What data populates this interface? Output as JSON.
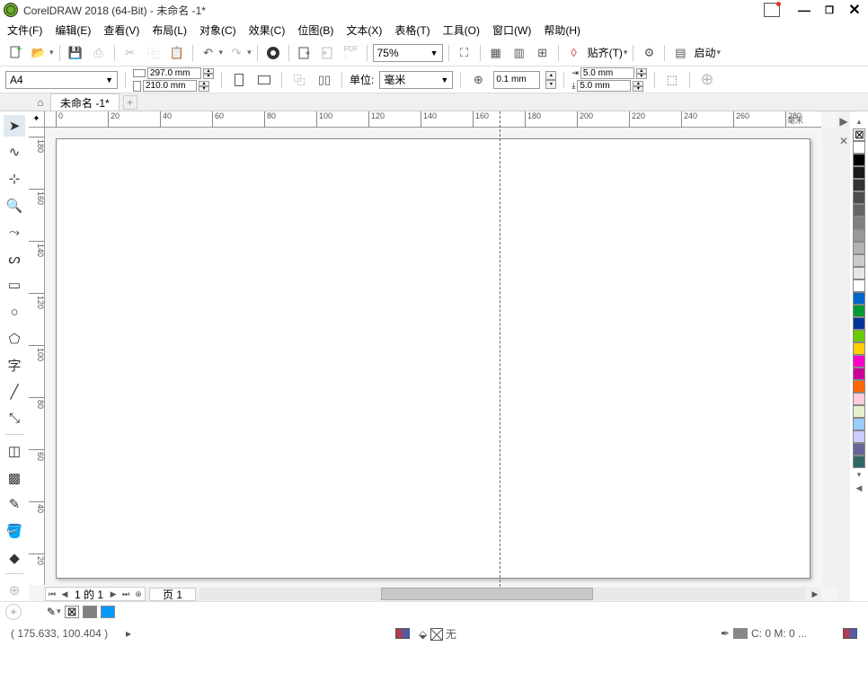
{
  "title": "CorelDRAW 2018 (64-Bit) - 未命名 -1*",
  "menu": {
    "file": "文件(F)",
    "edit": "编辑(E)",
    "view": "查看(V)",
    "layout": "布局(L)",
    "object": "对象(C)",
    "effects": "效果(C)",
    "bitmap": "位图(B)",
    "text": "文本(X)",
    "table": "表格(T)",
    "tools": "工具(O)",
    "window": "窗口(W)",
    "help": "帮助(H)"
  },
  "toolbar": {
    "zoom": "75%",
    "snap": "贴齐(T)",
    "launch": "启动"
  },
  "prop": {
    "paper": "A4",
    "w": "297.0 mm",
    "h": "210.0 mm",
    "unitlbl": "单位:",
    "unit": "毫米",
    "nudge": "0.1 mm",
    "dupx": "5.0 mm",
    "dupy": "5.0 mm"
  },
  "tab": {
    "name": "未命名 -1*"
  },
  "ruler": {
    "unit": "毫米",
    "ticks": [
      "0",
      "20",
      "40",
      "60",
      "80",
      "100",
      "120",
      "140",
      "160",
      "180",
      "200",
      "220",
      "240",
      "260",
      "280"
    ],
    "vticks": [
      "180",
      "160",
      "140",
      "120",
      "100",
      "80",
      "60",
      "40",
      "20"
    ]
  },
  "pages": {
    "label": "1 的 1",
    "tab": "页 1"
  },
  "status": {
    "coords": "( 175.633, 100.404 )",
    "fill": "无",
    "outline": "C: 0 M: 0 ..."
  },
  "palette": [
    "#fff",
    "#000",
    "#1a1a1a",
    "#333",
    "#4d4d4d",
    "#666",
    "#808080",
    "#999",
    "#b3b3b3",
    "#ccc",
    "#e6e6e6",
    "#fff",
    "#0066cc",
    "#009933",
    "#003399",
    "#66cc00",
    "#ffcc00",
    "#ff00cc",
    "#cc0099",
    "#ff6600",
    "#ffccd9",
    "#e6f0cc",
    "#99ccff",
    "#ccccff",
    "#666699",
    "#336666"
  ]
}
